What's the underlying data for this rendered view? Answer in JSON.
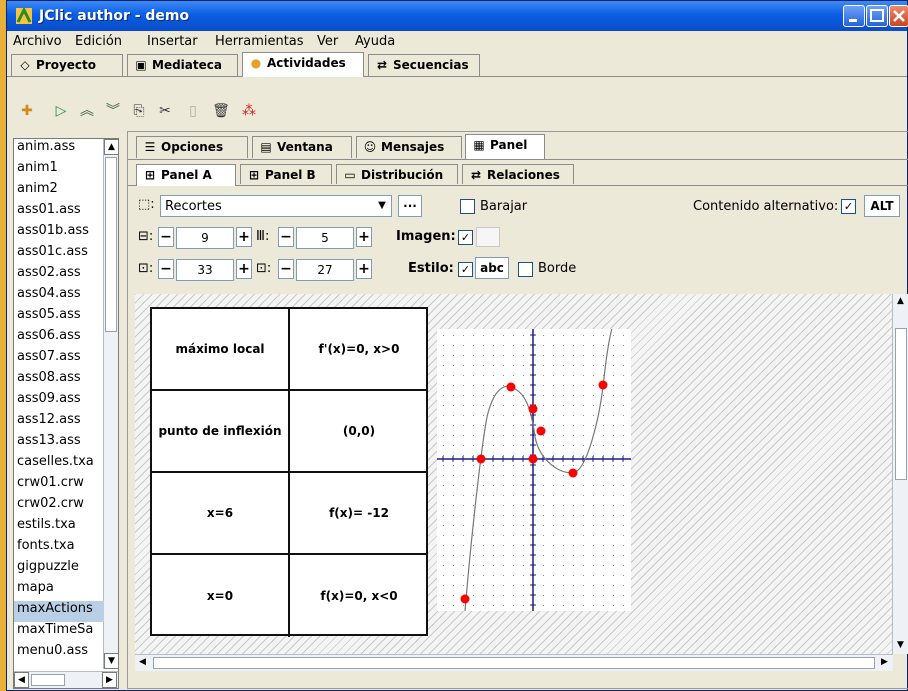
{
  "window": {
    "title": "JClic author - demo"
  },
  "menu": [
    "Archivo",
    "Edición",
    "Insertar",
    "Herramientas",
    "Ver",
    "Ayuda"
  ],
  "main_tabs": [
    {
      "label": "Proyecto",
      "icon": "project-icon"
    },
    {
      "label": "Mediateca",
      "icon": "media-library-icon"
    },
    {
      "label": "Actividades",
      "icon": "activities-icon"
    },
    {
      "label": "Secuencias",
      "icon": "sequences-icon"
    }
  ],
  "toolbar_icons": [
    "new-activity-icon",
    "play-icon",
    "move-up-icon",
    "move-down-icon",
    "copy-icon",
    "cut-icon",
    "paste-icon",
    "delete-icon",
    "shuffle-icon"
  ],
  "activities": [
    "anim.ass",
    "anim1",
    "anim2",
    "ass01.ass",
    "ass01b.ass",
    "ass01c.ass",
    "ass02.ass",
    "ass04.ass",
    "ass05.ass",
    "ass06.ass",
    "ass07.ass",
    "ass08.ass",
    "ass09.ass",
    "ass12.ass",
    "ass13.ass",
    "caselles.txa",
    "crw01.crw",
    "crw02.crw",
    "estils.txa",
    "fonts.txa",
    "gigpuzzle",
    "mapa",
    "maxActions",
    "maxTimeSa",
    "menu0.ass"
  ],
  "selected_activity": "maxActions",
  "sub_tabs": [
    {
      "label": "Opciones",
      "icon": "options-icon"
    },
    {
      "label": "Ventana",
      "icon": "window-icon"
    },
    {
      "label": "Mensajes",
      "icon": "messages-icon"
    },
    {
      "label": "Panel",
      "icon": "panel-icon"
    }
  ],
  "panel_tabs": [
    {
      "label": "Panel A",
      "icon": "panel-a-icon"
    },
    {
      "label": "Panel B",
      "icon": "panel-b-icon"
    },
    {
      "label": "Distribución",
      "icon": "layout-icon"
    },
    {
      "label": "Relaciones",
      "icon": "relations-icon"
    }
  ],
  "props": {
    "shaper_value": "Recortes",
    "shaper_btn": "...",
    "barajar_label": "Barajar",
    "alt_content_label": "Contenido alternativo:",
    "alt_btn": "ALT",
    "rows": "9",
    "cols": "5",
    "width": "33",
    "height": "27",
    "imagen_label": "Imagen:",
    "estilo_label": "Estilo:",
    "estilo_sample": "abc",
    "borde_label": "Borde",
    "minus": "−",
    "plus": "+"
  },
  "cells": [
    [
      "máximo local",
      "f'(x)=0, x>0"
    ],
    [
      "punto de inflexión",
      "(0,0)"
    ],
    [
      "x=6",
      "f(x)= -12"
    ],
    [
      "x=0",
      "f(x)=0, x<0"
    ]
  ],
  "colors": {
    "marker": "#ff0000",
    "axes": "#1a1a8a",
    "curve": "#777777",
    "selection": "#b8cfe5"
  }
}
